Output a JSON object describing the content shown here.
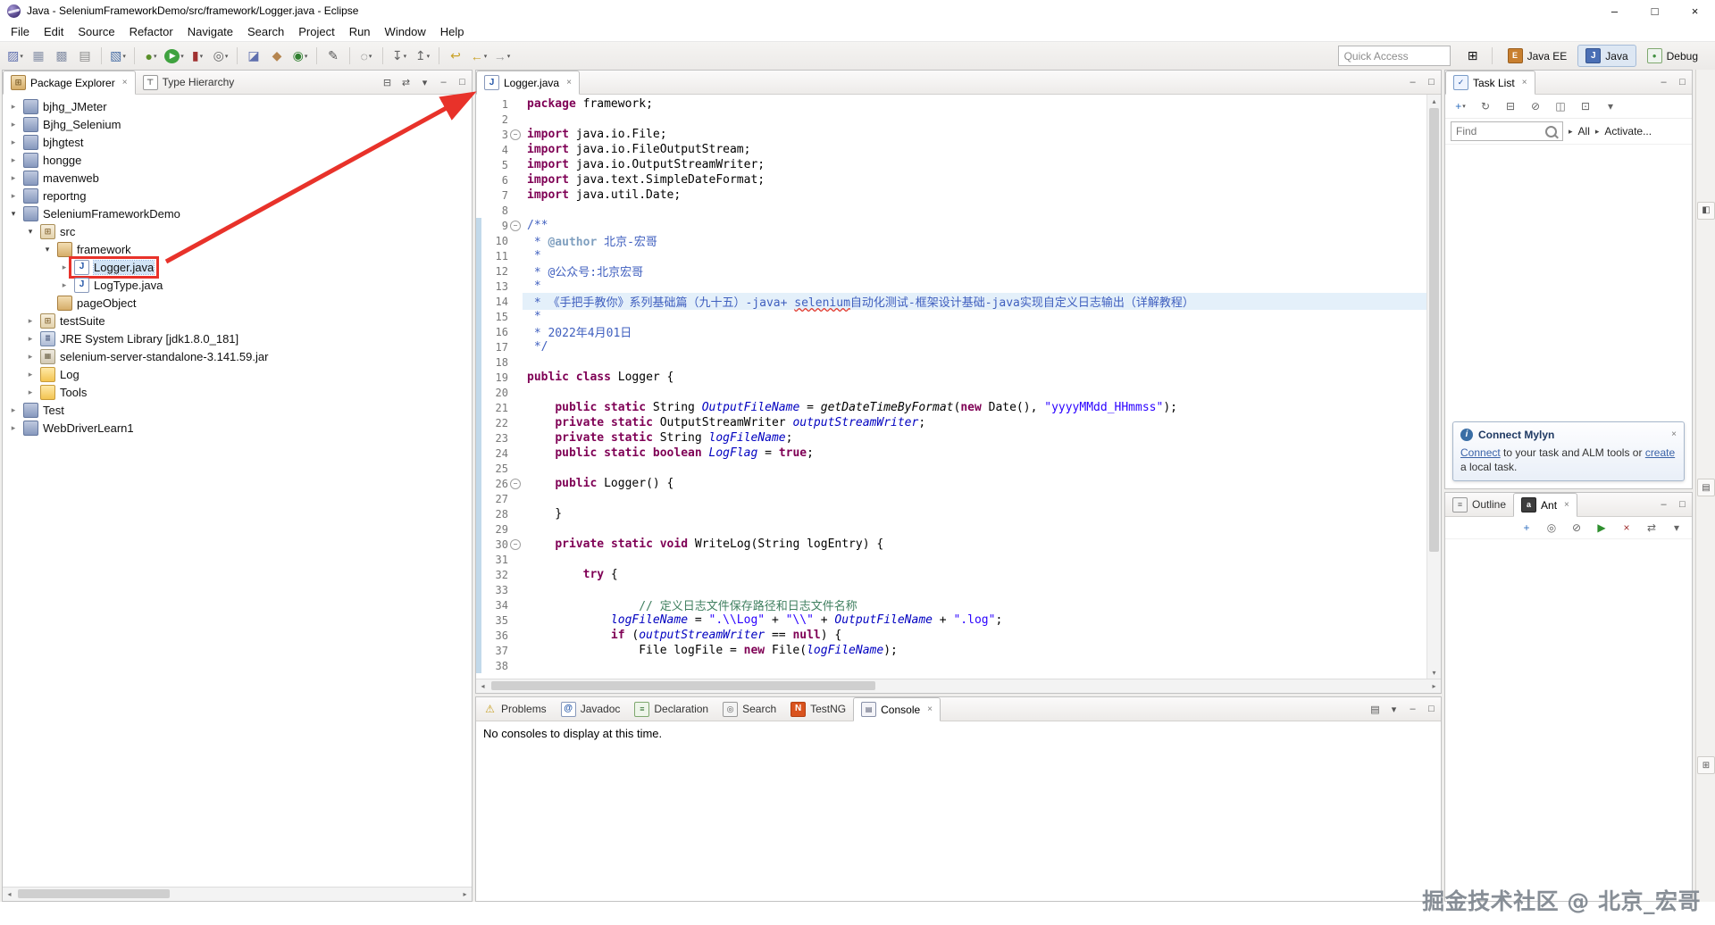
{
  "titlebar": {
    "title": "Java - SeleniumFrameworkDemo/src/framework/Logger.java - Eclipse",
    "minimize": "–",
    "maximize": "□",
    "close": "×"
  },
  "menubar": [
    "File",
    "Edit",
    "Source",
    "Refactor",
    "Navigate",
    "Search",
    "Project",
    "Run",
    "Window",
    "Help"
  ],
  "toolbar": {
    "quick_access": "Quick Access",
    "open_perspective_glyph": "⊞",
    "icons": [
      {
        "name": "new-wizard",
        "glyph": "▨",
        "fg": "#5f6fae",
        "dd": true
      },
      {
        "name": "save",
        "glyph": "▦",
        "fg": "#8892a8"
      },
      {
        "name": "save-all",
        "glyph": "▩",
        "fg": "#8892a8"
      },
      {
        "name": "print",
        "glyph": "▤",
        "fg": "#8a8a8a"
      },
      {
        "sep": true
      },
      {
        "name": "open-console",
        "glyph": "▧",
        "fg": "#4a6fa5",
        "dd": true
      },
      {
        "sep": true
      },
      {
        "name": "debug",
        "glyph": "●",
        "fg": "#5a8f29",
        "dd": true
      },
      {
        "name": "run",
        "glyph": "▶",
        "fg": "#ffffff",
        "bg": "#3fa23f",
        "dd": true
      },
      {
        "name": "coverage",
        "glyph": "▮",
        "fg": "#a03030",
        "dd": true
      },
      {
        "name": "run-external-tools",
        "glyph": "◎",
        "fg": "#666666",
        "dd": true
      },
      {
        "sep": true
      },
      {
        "name": "new-java-project",
        "glyph": "◪",
        "fg": "#5f6fae"
      },
      {
        "name": "new-package",
        "glyph": "◆",
        "fg": "#b5854f"
      },
      {
        "name": "new-class",
        "glyph": "◉",
        "fg": "#2f7f2f",
        "dd": true
      },
      {
        "sep": true
      },
      {
        "name": "open-task",
        "glyph": "✎",
        "fg": "#555555"
      },
      {
        "sep": true
      },
      {
        "name": "search",
        "glyph": "◌",
        "fg": "#555555",
        "dd": true
      },
      {
        "sep": true
      },
      {
        "name": "next-annotation",
        "glyph": "↧",
        "fg": "#666666",
        "dd": true
      },
      {
        "name": "previous-annotation",
        "glyph": "↥",
        "fg": "#666666",
        "dd": true
      },
      {
        "sep": true
      },
      {
        "name": "last-edit-location",
        "glyph": "↩",
        "fg": "#c9a227"
      },
      {
        "name": "back",
        "glyph": "←",
        "fg": "#c9a227",
        "dd": true
      },
      {
        "name": "forward",
        "glyph": "→",
        "fg": "#a0a0a0",
        "dd": true
      }
    ],
    "perspectives": [
      {
        "label": "Java EE",
        "icon": "javaee"
      },
      {
        "label": "Java",
        "icon": "javapersp",
        "active": true
      },
      {
        "label": "Debug",
        "icon": "debugpersp"
      }
    ]
  },
  "package_explorer": {
    "tabs": [
      {
        "label": "Package Explorer",
        "icon": "package-explorer",
        "active": true,
        "closable": true
      },
      {
        "label": "Type Hierarchy",
        "icon": "hierarchy"
      }
    ],
    "toolbar": [
      {
        "name": "collapse-all",
        "glyph": "⊟"
      },
      {
        "name": "link-with-editor",
        "glyph": "⇄"
      },
      {
        "name": "view-menu",
        "glyph": "▾"
      },
      {
        "name": "minimize",
        "glyph": "–"
      },
      {
        "name": "maximize",
        "glyph": "□"
      }
    ],
    "tree": [
      {
        "label": "bjhg_JMeter",
        "depth": 0,
        "state": "c",
        "icon": "project"
      },
      {
        "label": "Bjhg_Selenium",
        "depth": 0,
        "state": "c",
        "icon": "project"
      },
      {
        "label": "bjhgtest",
        "depth": 0,
        "state": "c",
        "icon": "project"
      },
      {
        "label": "hongge",
        "depth": 0,
        "state": "c",
        "icon": "project"
      },
      {
        "label": "mavenweb",
        "depth": 0,
        "state": "c",
        "icon": "project"
      },
      {
        "label": "reportng",
        "depth": 0,
        "state": "c",
        "icon": "project"
      },
      {
        "label": "SeleniumFrameworkDemo",
        "depth": 0,
        "state": "e",
        "icon": "project"
      },
      {
        "label": "src",
        "depth": 1,
        "state": "e",
        "icon": "src"
      },
      {
        "label": "framework",
        "depth": 2,
        "state": "e",
        "icon": "package"
      },
      {
        "label": "Logger.java",
        "depth": 3,
        "state": "c",
        "icon": "java",
        "selected": true,
        "annotated": true
      },
      {
        "label": "LogType.java",
        "depth": 3,
        "state": "c",
        "icon": "java"
      },
      {
        "label": "pageObject",
        "depth": 2,
        "state": "n",
        "icon": "package"
      },
      {
        "label": "testSuite",
        "depth": 1,
        "state": "c",
        "icon": "src"
      },
      {
        "label": "JRE System Library [jdk1.8.0_181]",
        "depth": 1,
        "state": "c",
        "icon": "library"
      },
      {
        "label": "selenium-server-standalone-3.141.59.jar",
        "depth": 1,
        "state": "c",
        "icon": "jar"
      },
      {
        "label": "Log",
        "depth": 1,
        "state": "c",
        "icon": "folder"
      },
      {
        "label": "Tools",
        "depth": 1,
        "state": "c",
        "icon": "folder"
      },
      {
        "label": "Test",
        "depth": 0,
        "state": "c",
        "icon": "project"
      },
      {
        "label": "WebDriverLearn1",
        "depth": 0,
        "state": "c",
        "icon": "project"
      }
    ]
  },
  "editor": {
    "tabs": [
      {
        "label": "Logger.java",
        "icon": "java",
        "active": true,
        "closable": true
      }
    ],
    "toolbar": [
      {
        "name": "minimize",
        "glyph": "–"
      },
      {
        "name": "maximize",
        "glyph": "□"
      }
    ],
    "lines": [
      {
        "n": 1,
        "t": [
          [
            "k",
            "package"
          ],
          [
            "p",
            " framework;"
          ]
        ]
      },
      {
        "n": 2
      },
      {
        "n": 3,
        "fold": 1,
        "t": [
          [
            "k",
            "import"
          ],
          [
            "p",
            " java.io.File;"
          ]
        ]
      },
      {
        "n": 4,
        "t": [
          [
            "k",
            "import"
          ],
          [
            "p",
            " java.io.FileOutputStream;"
          ]
        ]
      },
      {
        "n": 5,
        "t": [
          [
            "k",
            "import"
          ],
          [
            "p",
            " java.io.OutputStreamWriter;"
          ]
        ]
      },
      {
        "n": 6,
        "t": [
          [
            "k",
            "import"
          ],
          [
            "p",
            " java.text.SimpleDateFormat;"
          ]
        ]
      },
      {
        "n": 7,
        "t": [
          [
            "k",
            "import"
          ],
          [
            "p",
            " java.util.Date;"
          ]
        ]
      },
      {
        "n": 8
      },
      {
        "n": 9,
        "fold": 1,
        "d": 1,
        "t": [
          [
            "j",
            "/**"
          ]
        ]
      },
      {
        "n": 10,
        "d": 1,
        "t": [
          [
            "j",
            " * "
          ],
          [
            "jt",
            "@author"
          ],
          [
            "j",
            " 北京-宏哥"
          ]
        ]
      },
      {
        "n": 11,
        "d": 1,
        "t": [
          [
            "j",
            " *"
          ]
        ]
      },
      {
        "n": 12,
        "d": 1,
        "t": [
          [
            "j",
            " * @公众号:北京宏哥"
          ]
        ]
      },
      {
        "n": 13,
        "d": 1,
        "t": [
          [
            "j",
            " *"
          ]
        ]
      },
      {
        "n": 14,
        "d": 1,
        "hl": 1,
        "t": [
          [
            "j",
            " * 《手把手教你》系列基础篇（九十五）-java+ "
          ],
          [
            "ju",
            "selenium"
          ],
          [
            "j",
            "自动化测试-框架设计基础-java实现自定义日志输出（详解教程）"
          ]
        ]
      },
      {
        "n": 15,
        "d": 1,
        "t": [
          [
            "j",
            " *"
          ]
        ]
      },
      {
        "n": 16,
        "d": 1,
        "t": [
          [
            "j",
            " * 2022年4月01日"
          ]
        ]
      },
      {
        "n": 17,
        "d": 1,
        "t": [
          [
            "j",
            " */"
          ]
        ]
      },
      {
        "n": 18,
        "d": 1
      },
      {
        "n": 19,
        "d": 1,
        "t": [
          [
            "k",
            "public"
          ],
          [
            "p",
            " "
          ],
          [
            "k",
            "class"
          ],
          [
            "p",
            " Logger {"
          ]
        ]
      },
      {
        "n": 20,
        "d": 1
      },
      {
        "n": 21,
        "d": 1,
        "t": [
          [
            "p",
            "    "
          ],
          [
            "k",
            "public"
          ],
          [
            "p",
            " "
          ],
          [
            "k",
            "static"
          ],
          [
            "p",
            " String "
          ],
          [
            "f",
            "OutputFileName"
          ],
          [
            "p",
            " = "
          ],
          [
            "m",
            "getDateTimeByFormat"
          ],
          [
            "p",
            "("
          ],
          [
            "k",
            "new"
          ],
          [
            "p",
            " Date(), "
          ],
          [
            "s",
            "\"yyyyMMdd_HHmmss\""
          ],
          [
            "p",
            ");"
          ]
        ]
      },
      {
        "n": 22,
        "d": 1,
        "t": [
          [
            "p",
            "    "
          ],
          [
            "k",
            "private"
          ],
          [
            "p",
            " "
          ],
          [
            "k",
            "static"
          ],
          [
            "p",
            " OutputStreamWriter "
          ],
          [
            "f",
            "outputStreamWriter"
          ],
          [
            "p",
            ";"
          ]
        ]
      },
      {
        "n": 23,
        "d": 1,
        "t": [
          [
            "p",
            "    "
          ],
          [
            "k",
            "private"
          ],
          [
            "p",
            " "
          ],
          [
            "k",
            "static"
          ],
          [
            "p",
            " String "
          ],
          [
            "f",
            "logFileName"
          ],
          [
            "p",
            ";"
          ]
        ]
      },
      {
        "n": 24,
        "d": 1,
        "t": [
          [
            "p",
            "    "
          ],
          [
            "k",
            "public"
          ],
          [
            "p",
            " "
          ],
          [
            "k",
            "static"
          ],
          [
            "p",
            " "
          ],
          [
            "k",
            "boolean"
          ],
          [
            "p",
            " "
          ],
          [
            "f",
            "LogFlag"
          ],
          [
            "p",
            " = "
          ],
          [
            "k",
            "true"
          ],
          [
            "p",
            ";"
          ]
        ]
      },
      {
        "n": 25,
        "d": 1
      },
      {
        "n": 26,
        "d": 1,
        "fold": 1,
        "t": [
          [
            "p",
            "    "
          ],
          [
            "k",
            "public"
          ],
          [
            "p",
            " Logger() {"
          ]
        ]
      },
      {
        "n": 27,
        "d": 1
      },
      {
        "n": 28,
        "d": 1,
        "t": [
          [
            "p",
            "    }"
          ]
        ]
      },
      {
        "n": 29,
        "d": 1
      },
      {
        "n": 30,
        "d": 1,
        "fold": 1,
        "t": [
          [
            "p",
            "    "
          ],
          [
            "k",
            "private"
          ],
          [
            "p",
            " "
          ],
          [
            "k",
            "static"
          ],
          [
            "p",
            " "
          ],
          [
            "k",
            "void"
          ],
          [
            "p",
            " WriteLog(String logEntry) {"
          ]
        ]
      },
      {
        "n": 31,
        "d": 1
      },
      {
        "n": 32,
        "d": 1,
        "t": [
          [
            "p",
            "        "
          ],
          [
            "k",
            "try"
          ],
          [
            "p",
            " {"
          ]
        ]
      },
      {
        "n": 33,
        "d": 1
      },
      {
        "n": 34,
        "d": 1,
        "t": [
          [
            "p",
            "                "
          ],
          [
            "c",
            "// 定义日志文件保存路径和日志文件名称"
          ]
        ]
      },
      {
        "n": 35,
        "d": 1,
        "t": [
          [
            "p",
            "            "
          ],
          [
            "f",
            "logFileName"
          ],
          [
            "p",
            " = "
          ],
          [
            "s",
            "\".\\\\Log\""
          ],
          [
            "p",
            " + "
          ],
          [
            "s",
            "\"\\\\\""
          ],
          [
            "p",
            " + "
          ],
          [
            "f",
            "OutputFileName"
          ],
          [
            "p",
            " + "
          ],
          [
            "s",
            "\".log\""
          ],
          [
            "p",
            ";"
          ]
        ]
      },
      {
        "n": 36,
        "d": 1,
        "t": [
          [
            "p",
            "            "
          ],
          [
            "k",
            "if"
          ],
          [
            "p",
            " ("
          ],
          [
            "f",
            "outputStreamWriter"
          ],
          [
            "p",
            " == "
          ],
          [
            "k",
            "null"
          ],
          [
            "p",
            ") {"
          ]
        ]
      },
      {
        "n": 37,
        "d": 1,
        "t": [
          [
            "p",
            "                File logFile = "
          ],
          [
            "k",
            "new"
          ],
          [
            "p",
            " File("
          ],
          [
            "f",
            "logFileName"
          ],
          [
            "p",
            ");"
          ]
        ]
      },
      {
        "n": 38,
        "d": 1
      }
    ]
  },
  "bottom_panel": {
    "tabs": [
      {
        "label": "Problems",
        "icon": "problems"
      },
      {
        "label": "Javadoc",
        "icon": "javadoc"
      },
      {
        "label": "Declaration",
        "icon": "declaration"
      },
      {
        "label": "Search",
        "icon": "searchtab"
      },
      {
        "label": "TestNG",
        "icon": "testng"
      },
      {
        "label": "Console",
        "icon": "console",
        "active": true,
        "closable": true
      }
    ],
    "toolbar": [
      {
        "name": "open-console",
        "glyph": "▤"
      },
      {
        "name": "display-selected-console",
        "glyph": "▾"
      },
      {
        "name": "minimize",
        "glyph": "–"
      },
      {
        "name": "maximize",
        "glyph": "□"
      }
    ],
    "message": "No consoles to display at this time."
  },
  "task_list": {
    "tabs": [
      {
        "label": "Task List",
        "icon": "tasklist",
        "active": true,
        "closable": true
      }
    ],
    "window_buttons": [
      {
        "name": "minimize",
        "glyph": "–"
      },
      {
        "name": "maximize",
        "glyph": "□"
      }
    ],
    "toolbar": [
      {
        "name": "new-task",
        "glyph": "+",
        "fg": "#2f6fbf",
        "dd": true
      },
      {
        "name": "synchronize",
        "glyph": "↻",
        "fg": "#666666"
      },
      {
        "name": "categorized",
        "glyph": "⊟",
        "fg": "#666666"
      },
      {
        "name": "filter-completed",
        "glyph": "⊘",
        "fg": "#666666"
      },
      {
        "name": "focus-on-workweek",
        "glyph": "◫",
        "fg": "#666666"
      },
      {
        "name": "collapse-all",
        "glyph": "⊡",
        "fg": "#666666"
      },
      {
        "name": "view-menu",
        "glyph": "▾",
        "fg": "#666666"
      }
    ],
    "find_placeholder": "Find",
    "scope_all": "All",
    "activate_label": "Activate...",
    "mylyn": {
      "title": "Connect Mylyn",
      "link_connect": "Connect",
      "body_mid": "to your task and ALM tools or",
      "link_create": "create",
      "body_end": "a local task."
    }
  },
  "outline_ant": {
    "tabs": [
      {
        "label": "Outline",
        "icon": "outline"
      },
      {
        "label": "Ant",
        "icon": "ant",
        "active": true,
        "closable": true
      }
    ],
    "window_buttons": [
      {
        "name": "minimize",
        "glyph": "–"
      },
      {
        "name": "maximize",
        "glyph": "□"
      }
    ],
    "toolbar": [
      {
        "name": "add-buildfiles",
        "glyph": "+",
        "fg": "#2f6fbf"
      },
      {
        "name": "search-for-buildfiles",
        "glyph": "◎",
        "fg": "#666666"
      },
      {
        "name": "filter-internal-targets",
        "glyph": "⊘",
        "fg": "#666666"
      },
      {
        "name": "run-default-target",
        "glyph": "▶",
        "fg": "#2f8f2f"
      },
      {
        "name": "remove",
        "glyph": "×",
        "fg": "#a03030"
      },
      {
        "name": "link-with-editor",
        "glyph": "⇄",
        "fg": "#666666"
      },
      {
        "name": "view-menu",
        "glyph": "▾",
        "fg": "#666666"
      }
    ]
  },
  "right_strip": [
    {
      "name": "restore-view-1",
      "glyph": "◧"
    },
    {
      "name": "restore-view-2",
      "glyph": "▤"
    },
    {
      "name": "restore-view-3",
      "glyph": "⊞"
    }
  ],
  "watermark": "掘金技术社区 @ 北京_宏哥",
  "annotation_color": "#e8322a"
}
